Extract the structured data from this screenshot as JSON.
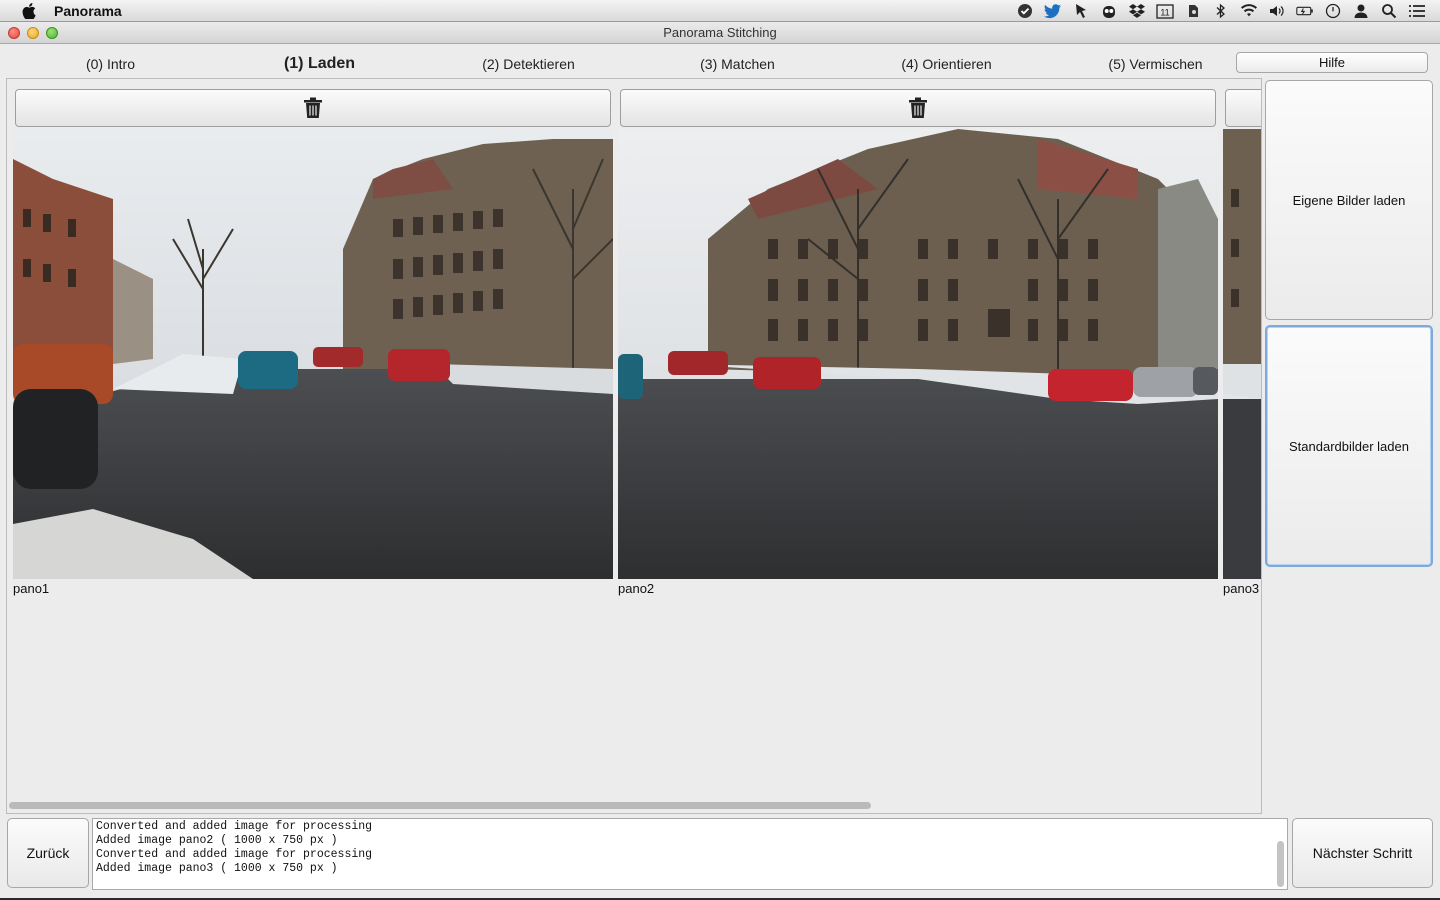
{
  "menubar": {
    "app_name": "Panorama",
    "status_icons": [
      "check-shield-icon",
      "twitter-icon",
      "cursor-icon",
      "owl-icon",
      "dropbox-icon",
      "calendar-icon",
      "evernote-icon",
      "bluetooth-icon",
      "wifi-icon",
      "volume-icon",
      "battery-icon",
      "clock-icon",
      "user-icon",
      "search-icon",
      "list-icon"
    ]
  },
  "window": {
    "title": "Panorama Stitching"
  },
  "tabs": [
    {
      "label": "(0) Intro"
    },
    {
      "label": "(1) Laden"
    },
    {
      "label": "(2) Detektieren"
    },
    {
      "label": "(3) Matchen"
    },
    {
      "label": "(4) Orientieren"
    },
    {
      "label": "(5) Vermischen"
    }
  ],
  "active_tab": 1,
  "help_button": "Hilfe",
  "images": [
    {
      "label": "pano1"
    },
    {
      "label": "pano2"
    },
    {
      "label": "pano3"
    }
  ],
  "side_buttons": {
    "load_own": "Eigene Bilder laden",
    "load_default": "Standardbilder laden"
  },
  "bottom": {
    "back": "Zurück",
    "next": "Nächster Schritt",
    "log_lines": [
      "Converted and added image for processing",
      "Added image pano2 ( 1000 x 750 px )",
      "Converted and added image for processing",
      "Added image pano3 ( 1000 x 750 px )"
    ]
  }
}
